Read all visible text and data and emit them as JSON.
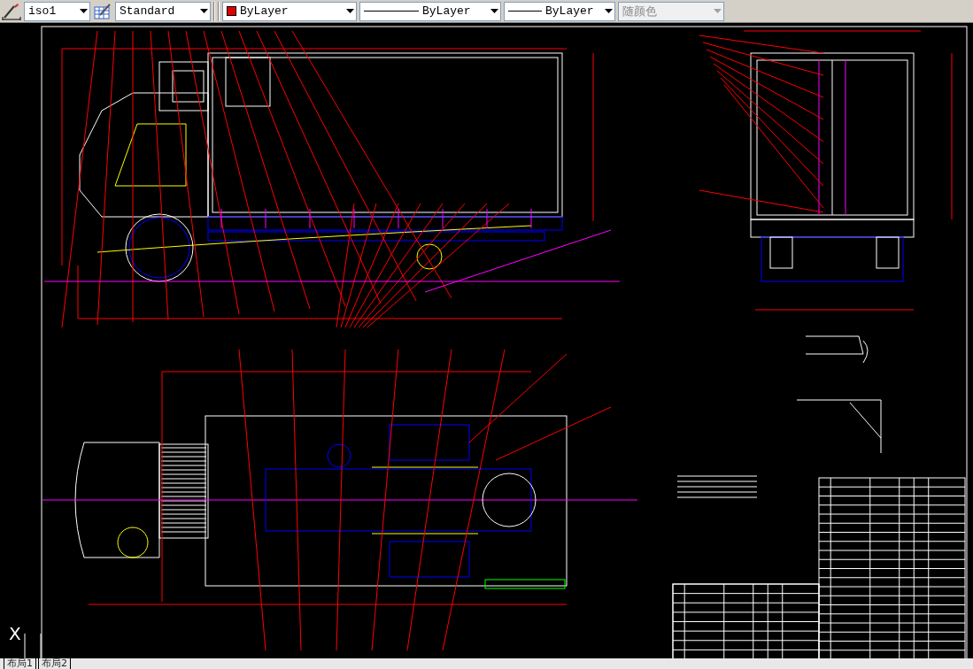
{
  "toolbar": {
    "dim_style": "iso1",
    "text_style": "Standard",
    "color_setting": "ByLayer",
    "linetype": "ByLayer",
    "lineweight": "ByLayer",
    "plot_style": {
      "label": "随颜色",
      "disabled": true
    }
  },
  "canvas": {
    "ucs_axis_label": "X"
  },
  "layout_tabs": [
    {
      "label": "布局1",
      "selected": false
    },
    {
      "label": "布局2",
      "selected": false
    }
  ]
}
